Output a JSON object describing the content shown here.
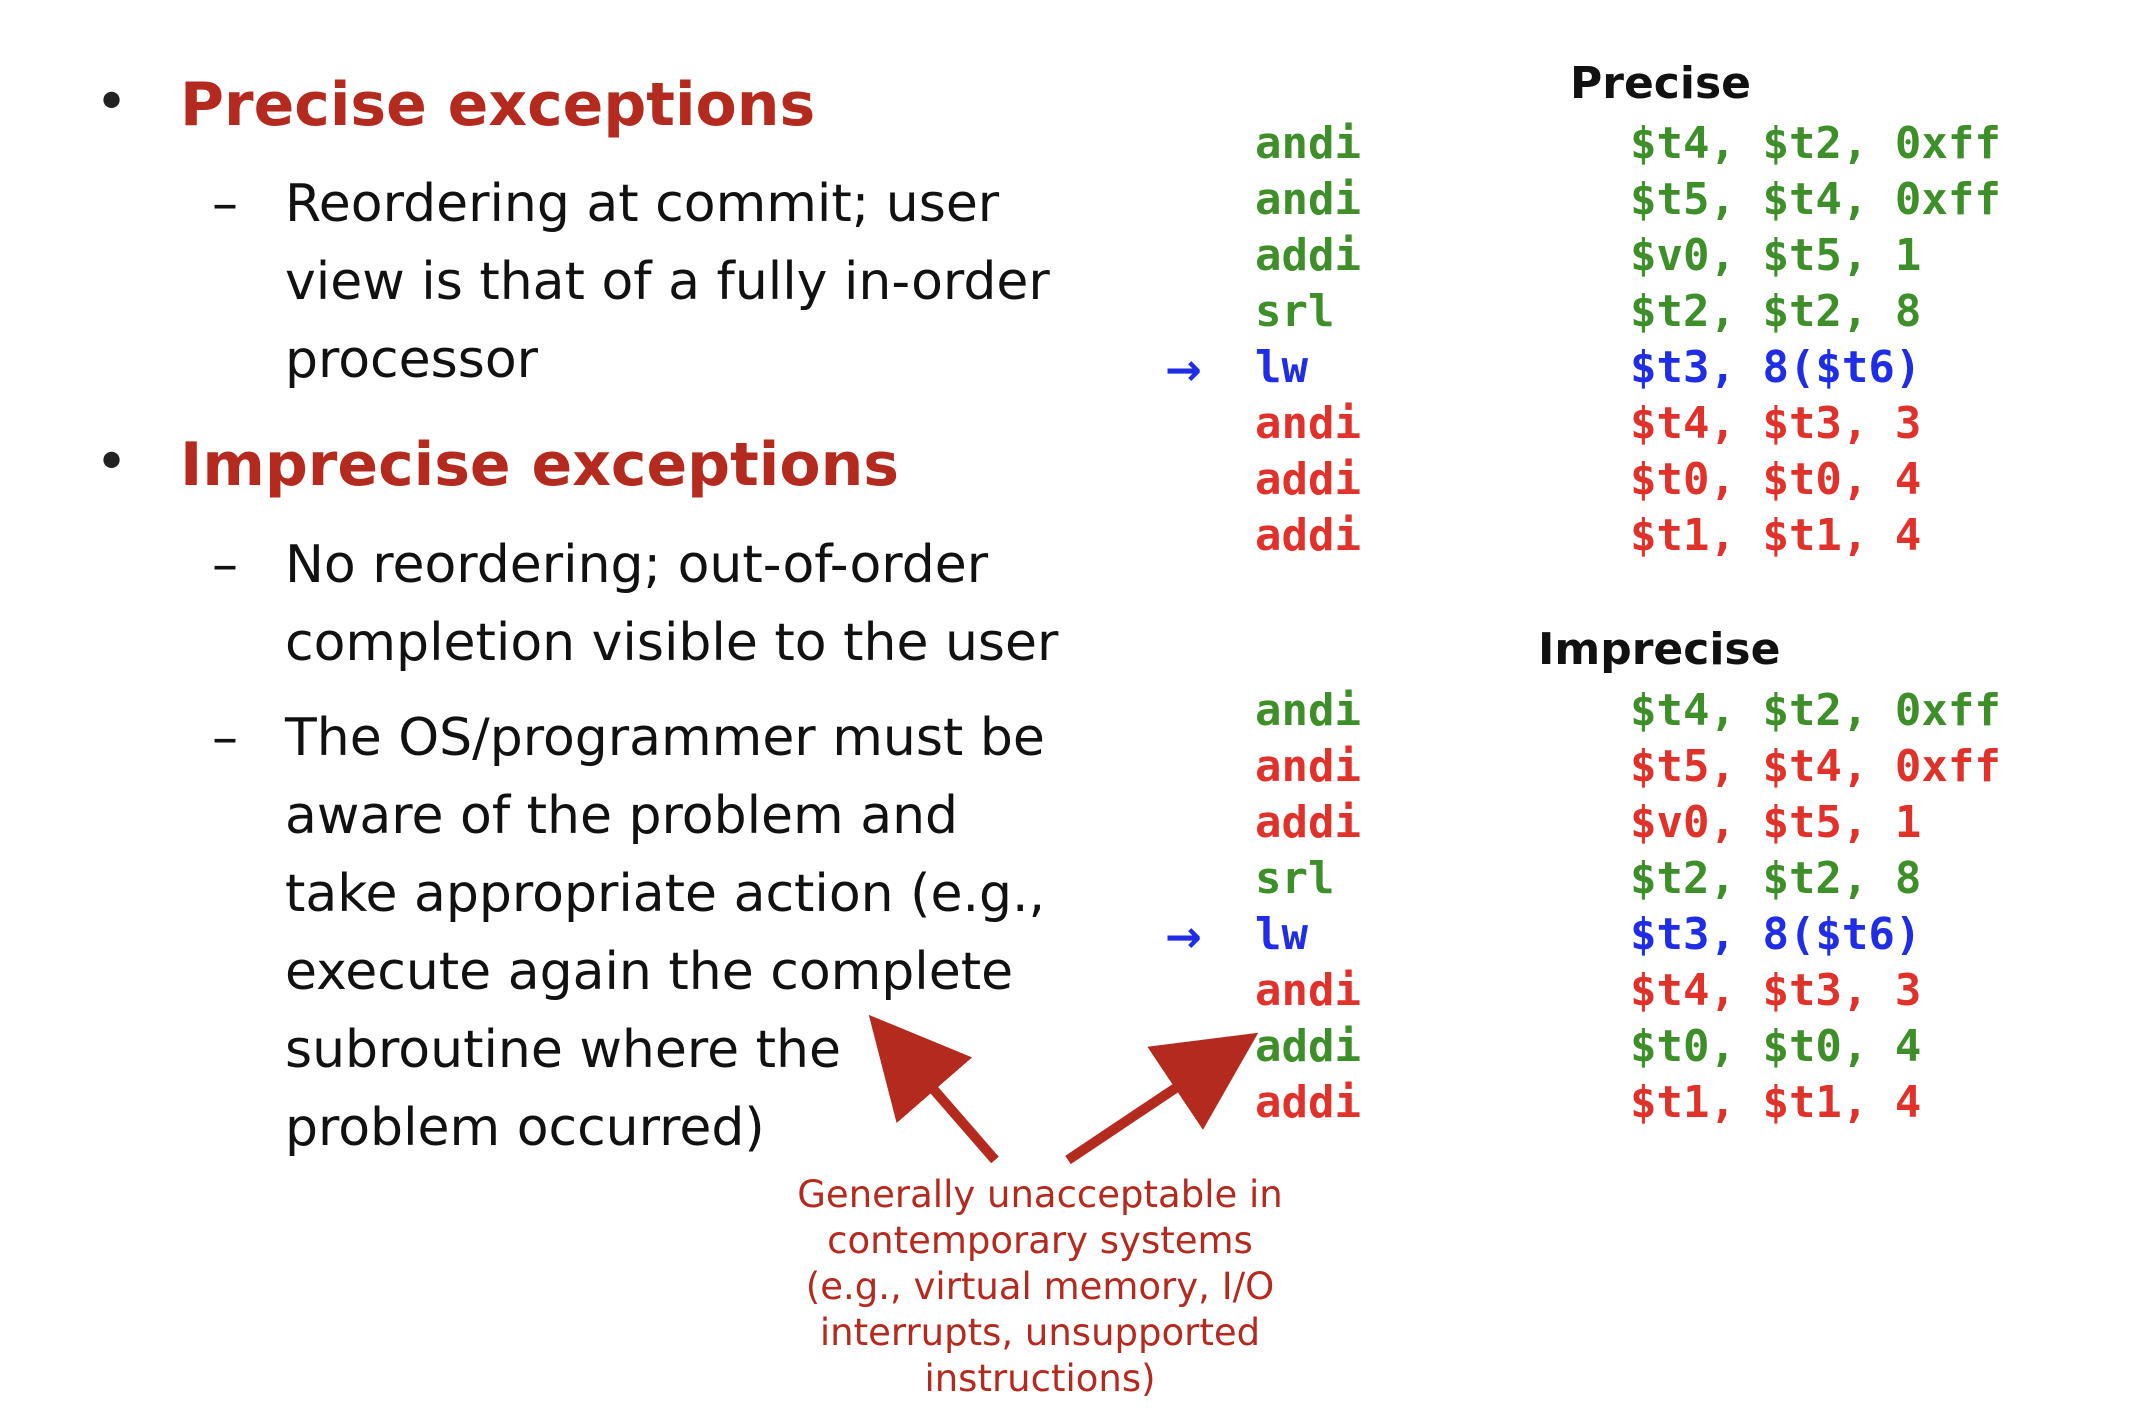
{
  "left": {
    "bullet1": {
      "title": "Precise exceptions",
      "subs": [
        {
          "lines": [
            "Reordering at commit; user",
            "view is that of a fully in-order",
            "processor"
          ]
        }
      ]
    },
    "bullet2": {
      "title": "Imprecise exceptions",
      "subs": [
        {
          "lines": [
            "No reordering; out-of-order",
            "completion visible to the user"
          ]
        },
        {
          "lines": [
            "The OS/programmer must be",
            "aware of the problem and",
            "take appropriate action (e.g.,",
            "execute again the complete",
            "subroutine where the",
            "problem occurred)"
          ]
        }
      ]
    },
    "bullet_glyph": "•",
    "dash_glyph": "–"
  },
  "precise": {
    "title": "Precise",
    "rows": [
      {
        "op": "andi",
        "args": "$t4, $t2, 0xff",
        "color": "#3e8e2a"
      },
      {
        "op": "andi",
        "args": "$t5, $t4, 0xff",
        "color": "#3e8e2a"
      },
      {
        "op": "addi",
        "args": "$v0, $t5, 1",
        "color": "#3e8e2a"
      },
      {
        "op": "srl",
        "args": "$t2, $t2, 8",
        "color": "#3e8e2a"
      },
      {
        "op": "lw",
        "args": "$t3, 8($t6)",
        "color": "#1f2ee6"
      },
      {
        "op": "andi",
        "args": "$t4, $t3, 3",
        "color": "#e0322b"
      },
      {
        "op": "addi",
        "args": "$t0, $t0, 4",
        "color": "#e0322b"
      },
      {
        "op": "addi",
        "args": "$t1, $t1, 4",
        "color": "#e0322b"
      }
    ]
  },
  "imprecise": {
    "title": "Imprecise",
    "rows": [
      {
        "op": "andi",
        "args": "$t4, $t2, 0xff",
        "color": "#3e8e2a"
      },
      {
        "op": "andi",
        "args": "$t5, $t4, 0xff",
        "color": "#e0322b"
      },
      {
        "op": "addi",
        "args": "$v0, $t5, 1",
        "color": "#e0322b"
      },
      {
        "op": "srl",
        "args": "$t2, $t2, 8",
        "color": "#3e8e2a"
      },
      {
        "op": "lw",
        "args": "$t3, 8($t6)",
        "color": "#1f2ee6"
      },
      {
        "op": "andi",
        "args": "$t4, $t3, 3",
        "color": "#e0322b"
      },
      {
        "op": "addi",
        "args": "$t0, $t0, 4",
        "color": "#3e8e2a"
      },
      {
        "op": "addi",
        "args": "$t1, $t1, 4",
        "color": "#e0322b"
      }
    ]
  },
  "pointer_glyph": "→",
  "note": {
    "lines": [
      "Generally unacceptable in",
      "contemporary systems",
      "(e.g., virtual memory, I/O",
      "interrupts, unsupported",
      "instructions)"
    ]
  },
  "colors": {
    "title_red": "#b52a1f",
    "green": "#3e8e2a",
    "red": "#e0322b",
    "blue": "#1f2ee6",
    "annotation_arrow": "#b52a1f"
  }
}
